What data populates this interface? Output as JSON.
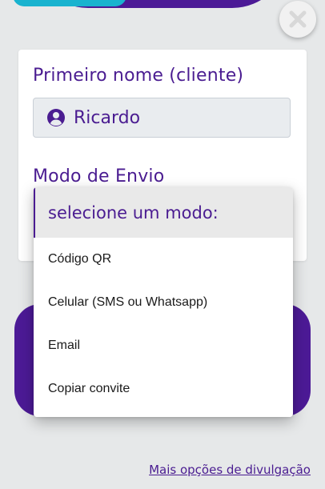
{
  "form": {
    "first_name_label": "Primeiro nome (cliente)",
    "first_name_value": "Ricardo",
    "send_mode_label": "Modo de Envio"
  },
  "dropdown": {
    "placeholder": "selecione um modo:",
    "options": [
      "Código QR",
      "Celular (SMS ou Whatsapp)",
      "Email",
      "Copiar convite"
    ]
  },
  "footer": {
    "more_options_link": "Mais opções de divulgação"
  },
  "icons": {
    "close": "close-icon",
    "user": "user-circle-icon"
  },
  "colors": {
    "primary": "#4a1c91",
    "accent": "#19b3cf",
    "background": "#e6e8e9"
  }
}
